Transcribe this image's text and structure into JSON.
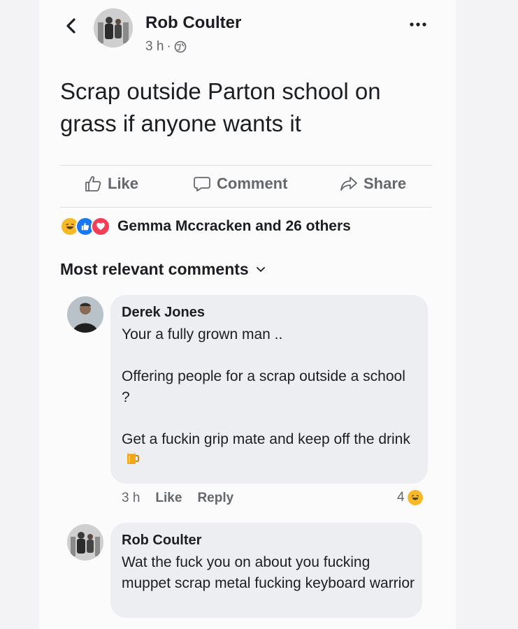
{
  "post": {
    "author": "Rob Coulter",
    "time": "3 h",
    "separator": "·",
    "text": "Scrap outside Parton school on grass if anyone wants it"
  },
  "actions": {
    "like": "Like",
    "comment": "Comment",
    "share": "Share"
  },
  "reactions": {
    "icons": [
      "haha-icon",
      "like-icon",
      "love-icon"
    ],
    "label": "Gemma Mccracken and 26 others"
  },
  "comments_header": "Most relevant comments",
  "comments": [
    {
      "author": "Derek Jones",
      "text": "Your a fully grown man ..\n\nOffering people for a scrap outside a school ?\n\nGet a fuckin grip mate and keep off the drink",
      "emoji": "beer-mug-icon",
      "time": "3 h",
      "like_label": "Like",
      "reply_label": "Reply",
      "reaction_count": "4",
      "reaction_icon": "haha-icon"
    },
    {
      "author": "Rob Coulter",
      "text": "Wat the fuck you on about you fucking muppet scrap metal fucking keyboard warrior"
    }
  ],
  "colors": {
    "background": "#fbfbfc",
    "bubble": "#eceef1",
    "secondary_text": "#65676b",
    "like_blue": "#1877f2",
    "love_red": "#f33e58",
    "haha_yellow": "#f7b928"
  }
}
